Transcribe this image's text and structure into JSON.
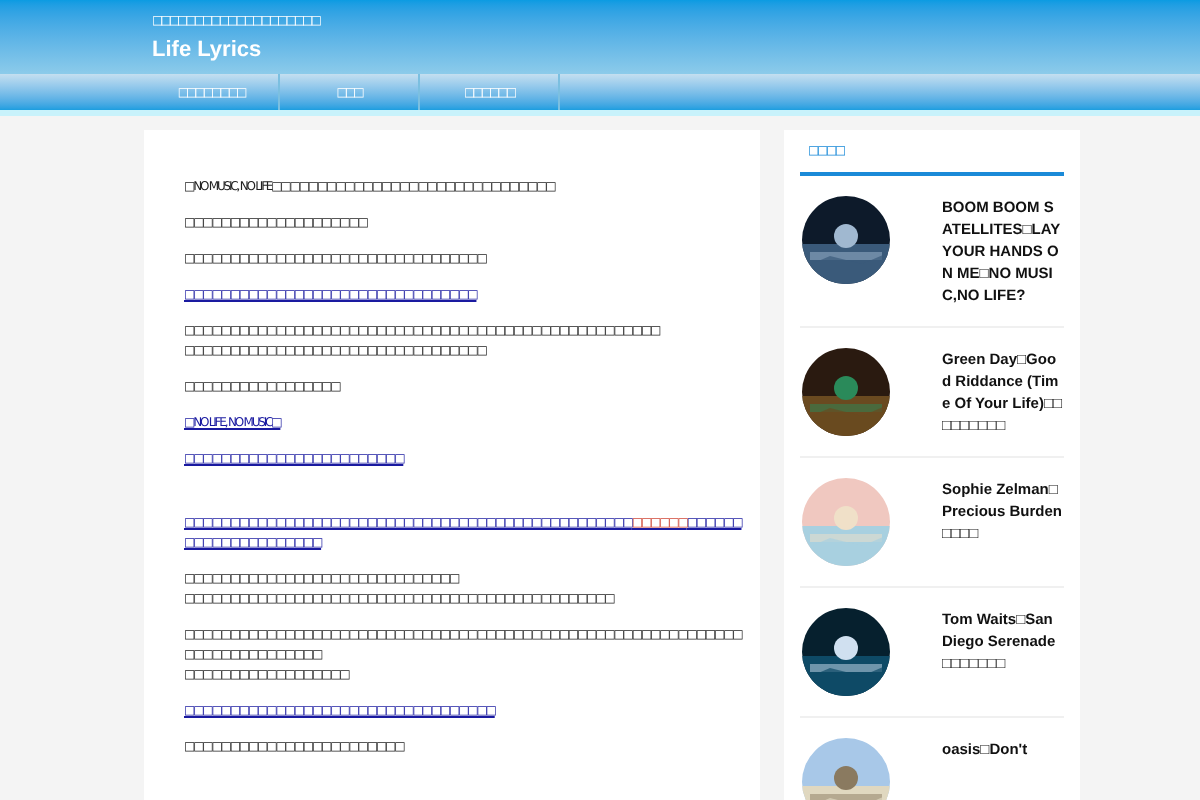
{
  "header": {
    "tagline": "□□□□□□□□□□□□□□□□□□□□",
    "title": "Life Lyrics"
  },
  "nav": [
    {
      "label": "□□□□□□□□"
    },
    {
      "label": "□□□"
    },
    {
      "label": "□□□□□□"
    }
  ],
  "article": [
    {
      "kind": "text",
      "lines": [
        "□NO MUSIC, NO LIFE□□□□□□□□□□□□□□□□□□□□□□□□□□□□□□□"
      ]
    },
    {
      "kind": "text",
      "lines": [
        "□□□□□□□□□□□□□□□□□□□□"
      ]
    },
    {
      "kind": "text",
      "lines": [
        "□□□□□□□□□□□□□□□□□□□□□□□□□□□□□□□□□"
      ]
    },
    {
      "kind": "link",
      "lines": [
        "□□□□□□□□□□□□□□□□□□□□□□□□□□□□□□□□"
      ]
    },
    {
      "kind": "text",
      "lines": [
        "□□□□□□□□□□□□□□□□□□□□□□□□□□□□□□□□□□□□□□□□□□□□□□□□□□□□",
        "□□□□□□□□□□□□□□□□□□□□□□□□□□□□□□□□□"
      ]
    },
    {
      "kind": "text",
      "lines": [
        "□□□□□□□□□□□□□□□□□"
      ]
    },
    {
      "kind": "link",
      "lines": [
        "□NO LIFE, NO MUSIC□"
      ]
    },
    {
      "kind": "link",
      "lines": [
        "□□□□□□□□□□□□□□□□□□□□□□□□"
      ]
    },
    {
      "kind": "gap"
    },
    {
      "kind": "link",
      "lines": [
        "□□□□□□□□□□□□□□□□□□□□□□□□□□□□□□□□□□□□□□□□□□□□□□□□□**□□□□□□**□□□□□□□□□□□□□□□□□□□□□"
      ]
    },
    {
      "kind": "text",
      "lines": [
        "□□□□□□□□□□□□□□□□□□□□□□□□□□□□□□",
        "□□□□□□□□□□□□□□□□□□□□□□□□□□□□□□□□□□□□□□□□□□□□□□□"
      ]
    },
    {
      "kind": "text",
      "lines": [
        "□□□□□□□□□□□□□□□□□□□□□□□□□□□□□□□□□□□□□□□□□□□□□□□□□□□□□□□□□□□□□□□□□□□□□□□□□□□□",
        "□□□□□□□□□□□□□□□□□□"
      ]
    },
    {
      "kind": "link",
      "lines": [
        "□□□□□□□□□□□□□□□□□□□□□□□□□□□□□□□□□□"
      ]
    },
    {
      "kind": "text",
      "lines": [
        "□□□□□□□□□□□□□□□□□□□□□□□□"
      ]
    }
  ],
  "sidebar": {
    "heading": "□□□□",
    "posts": [
      {
        "title": "BOOM BOOM SATELLITES□LAY YOUR HANDS ON ME□NO MUSIC,NO LIFE?"
      },
      {
        "title": "Green Day□Good Riddance (Time Of Your Life)□□□□□□□□□"
      },
      {
        "title": "Sophie Zelman□Precious Burden□□□□"
      },
      {
        "title": "Tom Waits□San Diego Serenade□□□□□□□"
      },
      {
        "title": "oasis□Don't"
      }
    ]
  }
}
